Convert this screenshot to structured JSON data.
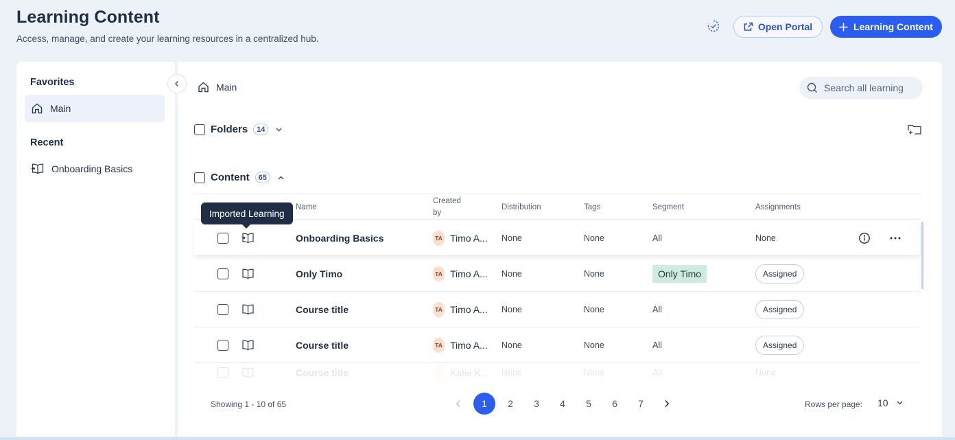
{
  "header": {
    "title": "Learning Content",
    "subtitle": "Access, manage, and create your learning resources in a centralized hub.",
    "open_portal_label": "Open Portal",
    "add_label": "Learning Content"
  },
  "sidebar": {
    "favorites_heading": "Favorites",
    "favorites": [
      {
        "label": "Main",
        "icon": "home-icon"
      }
    ],
    "recent_heading": "Recent",
    "recent": [
      {
        "label": "Onboarding Basics",
        "icon": "book-import-icon"
      }
    ]
  },
  "main": {
    "breadcrumb": "Main",
    "search_placeholder": "Search all learning",
    "folders": {
      "label": "Folders",
      "count": "14"
    },
    "content": {
      "label": "Content",
      "count": "65"
    },
    "columns": {
      "name": "Name",
      "created_by_1": "Created",
      "created_by_2": "by",
      "distribution": "Distribution",
      "tags": "Tags",
      "segment": "Segment",
      "assignments": "Assignments"
    },
    "tooltip": "Imported Learning",
    "rows": [
      {
        "name": "Onboarding Basics",
        "avatar": "TA",
        "creator": "Timo A...",
        "distribution": "None",
        "tags": "None",
        "segment": "All",
        "assignments": "None"
      },
      {
        "name": "Only Timo",
        "avatar": "TA",
        "creator": "Timo A...",
        "distribution": "None",
        "tags": "None",
        "segment": "Only Timo",
        "assignments": "Assigned"
      },
      {
        "name": "Course title",
        "avatar": "TA",
        "creator": "Timo A...",
        "distribution": "None",
        "tags": "None",
        "segment": "All",
        "assignments": "Assigned"
      },
      {
        "name": "Course title",
        "avatar": "TA",
        "creator": "Timo A...",
        "distribution": "None",
        "tags": "None",
        "segment": "All",
        "assignments": "Assigned"
      },
      {
        "name": "Course title",
        "avatar": "",
        "creator": "Katie K...",
        "distribution": "None",
        "tags": "None",
        "segment": "All",
        "assignments": "None"
      }
    ],
    "footer": {
      "showing": "Showing 1 - 10 of 65",
      "pages": [
        "1",
        "2",
        "3",
        "4",
        "5",
        "6",
        "7"
      ],
      "current_page": "1",
      "rows_per_page_label": "Rows per page:",
      "rows_per_page": "10"
    }
  },
  "colors": {
    "accent": "#2b5ef0",
    "segment_chip": "#cdebe0",
    "avatar_bg": "#fbe0d2"
  }
}
